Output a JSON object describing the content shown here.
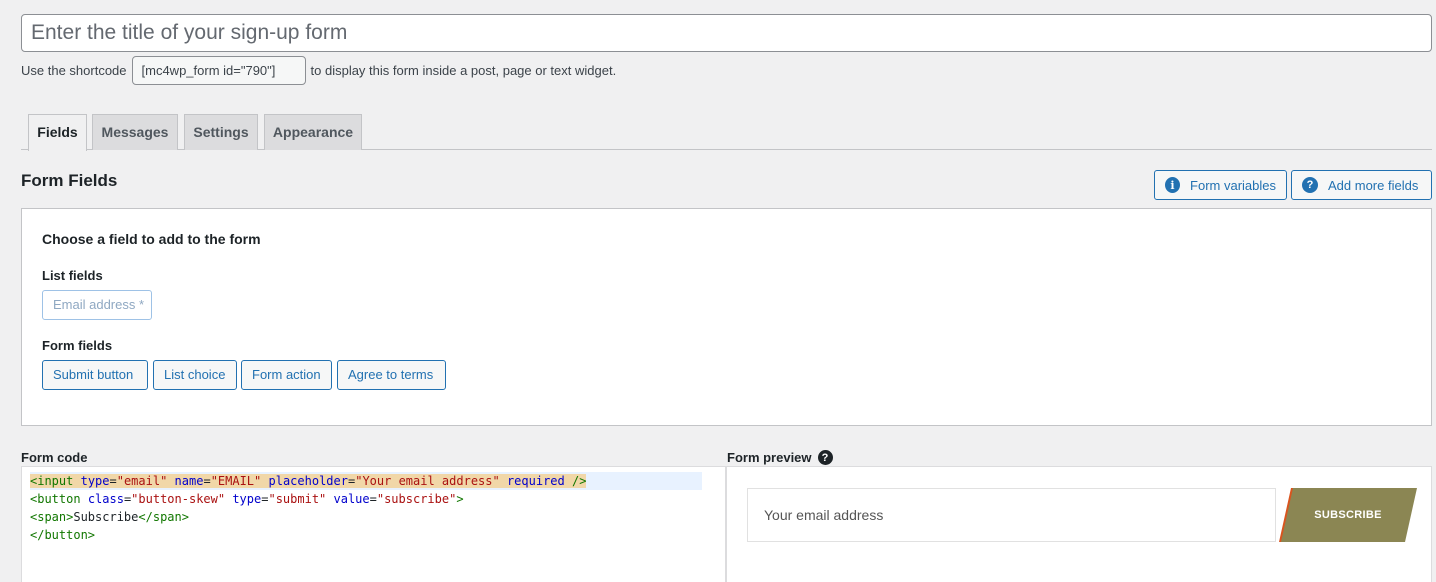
{
  "form_title": {
    "placeholder": "Enter the title of your sign-up form",
    "value": ""
  },
  "shortcode": {
    "prefix": "Use the shortcode",
    "code": "[mc4wp_form id=\"790\"]",
    "suffix": "to display this form inside a post, page or text widget."
  },
  "tabs": [
    {
      "label": "Fields",
      "active": true
    },
    {
      "label": "Messages",
      "active": false
    },
    {
      "label": "Settings",
      "active": false
    },
    {
      "label": "Appearance",
      "active": false
    }
  ],
  "section_title": "Form Fields",
  "header_buttons": {
    "form_variables": {
      "label": "Form variables",
      "icon": "info-icon"
    },
    "add_more_fields": {
      "label": "Add more fields",
      "icon": "question-icon"
    }
  },
  "field_chooser": {
    "heading": "Choose a field to add to the form",
    "list_fields_label": "List fields",
    "list_fields": [
      "Email address *"
    ],
    "form_fields_label": "Form fields",
    "form_fields": [
      "Submit button",
      "List choice",
      "Form action",
      "Agree to terms"
    ]
  },
  "form_code": {
    "label": "Form code",
    "lines": [
      "<input type=\"email\" name=\"EMAIL\" placeholder=\"Your email address\" required />",
      "<button class=\"button-skew\" type=\"submit\" value=\"subscribe\">",
      "<span>Subscribe</span>",
      "</button>"
    ]
  },
  "form_preview": {
    "label": "Form preview",
    "email_placeholder": "Your email address",
    "submit_label": "SUBSCRIBE",
    "button_color": "#8b8653",
    "accent_color": "#d9541e"
  }
}
